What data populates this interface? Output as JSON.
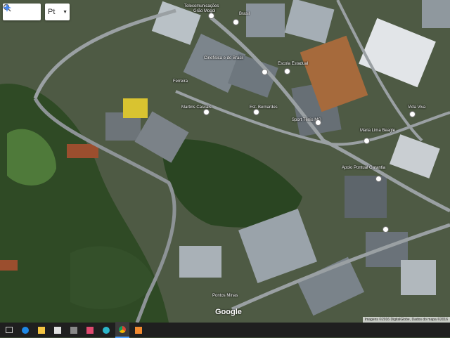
{
  "map": {
    "language_button": "Pt",
    "attribution_copy": "Imagens ©2016 DigitalGlobe, Dados do mapa ©2016",
    "logo": "Google",
    "labels": [
      {
        "name": "label-telecom",
        "text": "Telecomunicações"
      },
      {
        "name": "label-grao-mogol",
        "text": "Grão Mogol"
      },
      {
        "name": "label-brasil",
        "text": "Brasil"
      },
      {
        "name": "label-cine",
        "text": "Cinefisica e do Brasil"
      },
      {
        "name": "label-escola",
        "text": "Escola Estadual"
      },
      {
        "name": "label-martins",
        "text": "Martins Cascais"
      },
      {
        "name": "label-ferreira",
        "text": "Ferreira"
      },
      {
        "name": "label-bernardes",
        "text": "Est. Bernardes"
      },
      {
        "name": "label-sport",
        "text": "Sport Tênis MG"
      },
      {
        "name": "label-maria",
        "text": "Maria Lima Beagle"
      },
      {
        "name": "label-apoio",
        "text": "Apoio Pontual Garantia"
      },
      {
        "name": "label-vida",
        "text": "Vida Viva"
      },
      {
        "name": "label-pontos",
        "text": "Pontos Minas"
      }
    ]
  },
  "taskbar": {
    "icons": [
      "task-view-icon",
      "edge-icon",
      "file-explorer-icon",
      "store-icon",
      "photos-icon",
      "media-icon",
      "app-icon",
      "chrome-icon",
      "paint-icon"
    ]
  }
}
